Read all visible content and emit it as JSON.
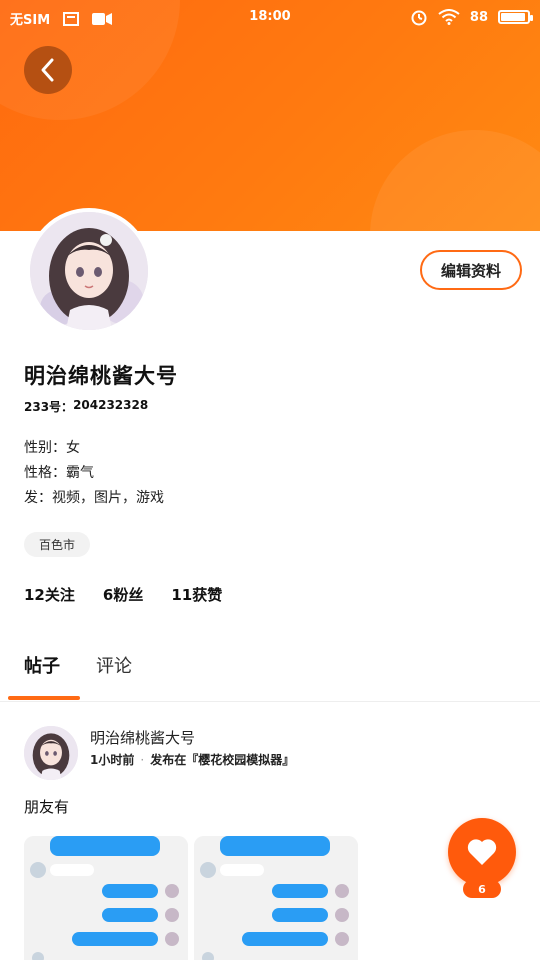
{
  "status_bar": {
    "carrier": "无SIM",
    "time": "18:00",
    "battery": "88"
  },
  "profile": {
    "name": "明治绵桃酱大号",
    "uid_label": "233号：",
    "uid_value": "204232328",
    "edit_button": "编辑资料",
    "bio": [
      "性别：女",
      "性格：霸气",
      "发：视频，图片，游戏"
    ],
    "city": "百色市",
    "stats": [
      {
        "count": "12",
        "label": "关注"
      },
      {
        "count": "6",
        "label": "粉丝"
      },
      {
        "count": "11",
        "label": "获赞"
      }
    ]
  },
  "tabs": [
    {
      "label": "帖子",
      "active": true
    },
    {
      "label": "评论",
      "active": false
    }
  ],
  "post": {
    "author": "明治绵桃酱大号",
    "time": "1小时前",
    "published_in": "发布在『樱花校园模拟器』",
    "text": "朋友有",
    "like_count": "6"
  },
  "colors": {
    "accent": "#ff6a14",
    "header_gradient_start": "#ff6a0f",
    "header_gradient_end": "#ff8a12",
    "chat_bubble": "#2a9df4"
  },
  "icons": {
    "back": "chevron-left-icon",
    "like": "heart-icon",
    "wifi": "wifi-icon",
    "alarm": "alarm-icon",
    "battery": "battery-icon"
  }
}
